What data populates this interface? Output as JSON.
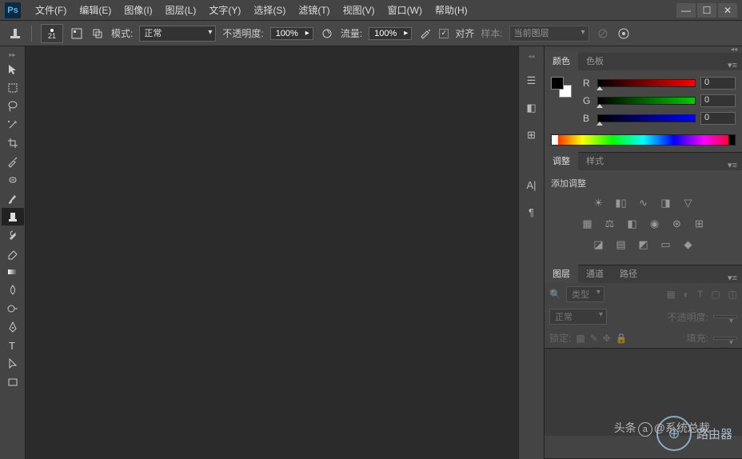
{
  "app": {
    "logo_text": "Ps"
  },
  "window_controls": {
    "minimize": "—",
    "maximize": "☐",
    "close": "✕"
  },
  "menu": [
    "文件(F)",
    "编辑(E)",
    "图像(I)",
    "图层(L)",
    "文字(Y)",
    "选择(S)",
    "滤镜(T)",
    "视图(V)",
    "窗口(W)",
    "帮助(H)"
  ],
  "options": {
    "brush_size": "21",
    "mode_label": "模式:",
    "mode_value": "正常",
    "opacity_label": "不透明度:",
    "opacity_value": "100%",
    "flow_label": "流量:",
    "flow_value": "100%",
    "align_label": "对齐",
    "align_checked": "✓",
    "sample_label": "样本:",
    "sample_value": "当前图层"
  },
  "panels": {
    "color": {
      "tab1": "颜色",
      "tab2": "色板",
      "r_label": "R",
      "g_label": "G",
      "b_label": "B",
      "r_value": "0",
      "g_value": "0",
      "b_value": "0"
    },
    "adjust": {
      "tab1": "调整",
      "tab2": "样式",
      "title": "添加调整"
    },
    "layers": {
      "tab1": "图层",
      "tab2": "通道",
      "tab3": "路径",
      "kind_label": "类型",
      "blend_value": "正常",
      "opacity_label": "不透明度:",
      "lock_label": "锁定:",
      "fill_label": "填充:"
    }
  },
  "watermarks": {
    "circle_text": "路由器",
    "text2_prefix": "头条",
    "text2_handle": "@系统总裁"
  }
}
